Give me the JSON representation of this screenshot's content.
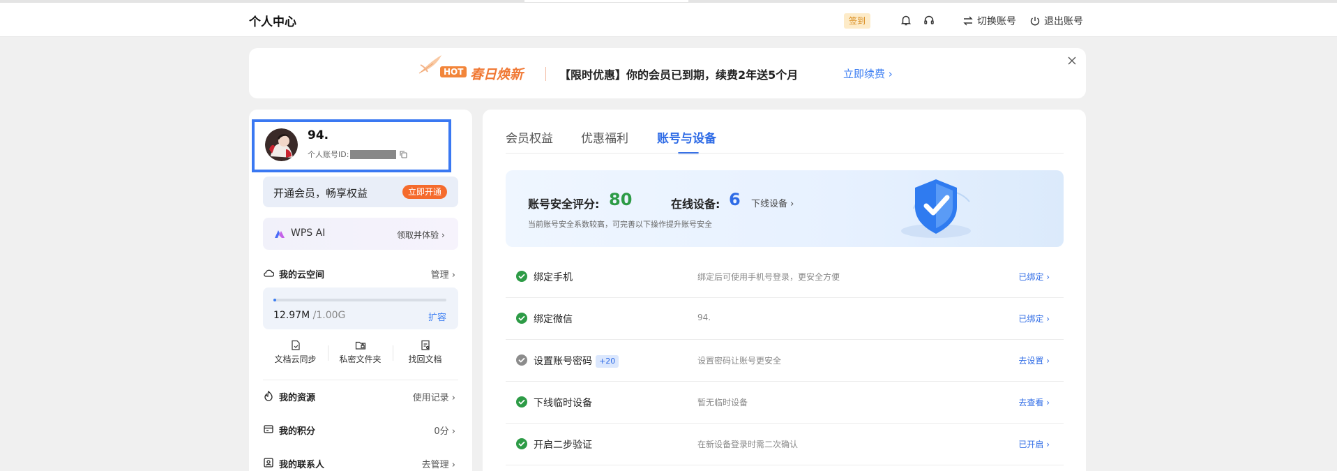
{
  "header": {
    "title": "个人中心",
    "signin": "签到",
    "switch_account": "切换账号",
    "logout": "退出账号"
  },
  "banner": {
    "hot": "HOT",
    "campaign": "春日焕新",
    "message": "【限时优惠】你的会员已到期，续费2年送5个月",
    "cta": "立即续费"
  },
  "profile": {
    "name": "94.",
    "id_label": "个人账号ID:"
  },
  "vip": {
    "text": "开通会员，畅享权益",
    "button": "立即开通"
  },
  "wps_ai": {
    "label": "WPS AI",
    "link": "领取并体验"
  },
  "cloud": {
    "title": "我的云空间",
    "manage": "管理",
    "used": "12.97M",
    "total": "/1.00G",
    "used_fraction": 0.013,
    "expand": "扩容",
    "tools": [
      "文档云同步",
      "私密文件夹",
      "找回文档"
    ]
  },
  "sections": [
    {
      "title": "我的资源",
      "link": "使用记录"
    },
    {
      "title": "我的积分",
      "link": "0分"
    },
    {
      "title": "我的联系人",
      "link": "去管理"
    }
  ],
  "tabs": [
    "会员权益",
    "优惠福利",
    "账号与设备"
  ],
  "active_tab": "账号与设备",
  "security": {
    "score_label": "账号安全评分:",
    "score": "80",
    "devices_label": "在线设备:",
    "devices": "6",
    "devices_link": "下线设备",
    "note": "当前账号安全系数较高，可完善以下操作提升账号安全"
  },
  "items": [
    {
      "title": "绑定手机",
      "badge": "",
      "desc": "绑定后可使用手机号登录，更安全方便",
      "action": "已绑定",
      "done": true
    },
    {
      "title": "绑定微信",
      "badge": "",
      "desc": "94.",
      "action": "已绑定",
      "done": true
    },
    {
      "title": "设置账号密码",
      "badge": "+20",
      "desc": "设置密码让账号更安全",
      "action": "去设置",
      "done": false
    },
    {
      "title": "下线临时设备",
      "badge": "",
      "desc": "暂无临时设备",
      "action": "去查看",
      "done": true
    },
    {
      "title": "开启二步验证",
      "badge": "",
      "desc": "在新设备登录时需二次确认",
      "action": "已开启",
      "done": true
    }
  ],
  "colors": {
    "accent": "#2e6be6",
    "success": "#2d9b46",
    "orange": "#f56b2d",
    "pending": "#8c8c8c"
  }
}
